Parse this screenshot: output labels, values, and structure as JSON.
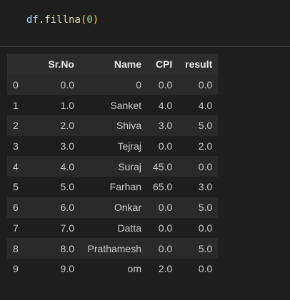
{
  "code_cell": {
    "var": "df",
    "dot": ".",
    "func": "fillna",
    "open_paren": "(",
    "arg": "0",
    "close_paren": ")"
  },
  "table": {
    "columns": [
      "",
      "Sr.No",
      "Name",
      "CPI",
      "result"
    ],
    "rows": [
      {
        "index": "0",
        "srno": "0.0",
        "name": "0",
        "cpi": "0.0",
        "result": "0.0"
      },
      {
        "index": "1",
        "srno": "1.0",
        "name": "Sanket",
        "cpi": "4.0",
        "result": "4.0"
      },
      {
        "index": "2",
        "srno": "2.0",
        "name": "Shiva",
        "cpi": "3.0",
        "result": "5.0"
      },
      {
        "index": "3",
        "srno": "3.0",
        "name": "Tejraj",
        "cpi": "0.0",
        "result": "2.0"
      },
      {
        "index": "4",
        "srno": "4.0",
        "name": "Suraj",
        "cpi": "45.0",
        "result": "0.0"
      },
      {
        "index": "5",
        "srno": "5.0",
        "name": "Farhan",
        "cpi": "65.0",
        "result": "3.0"
      },
      {
        "index": "6",
        "srno": "6.0",
        "name": "Onkar",
        "cpi": "0.0",
        "result": "5.0"
      },
      {
        "index": "7",
        "srno": "7.0",
        "name": "Datta",
        "cpi": "0.0",
        "result": "0.0"
      },
      {
        "index": "8",
        "srno": "8.0",
        "name": "Prathamesh",
        "cpi": "0.0",
        "result": "5.0"
      },
      {
        "index": "9",
        "srno": "9.0",
        "name": "om",
        "cpi": "2.0",
        "result": "0.0"
      }
    ]
  },
  "colors": {
    "background": "#1e1e1e",
    "header_background": "#2d2d2d",
    "stripe_background": "#2a2a2a",
    "code_variable": "#9cdcfe",
    "code_function": "#dcdcaa",
    "code_paren": "#ffd700",
    "code_number": "#b5cea8"
  }
}
